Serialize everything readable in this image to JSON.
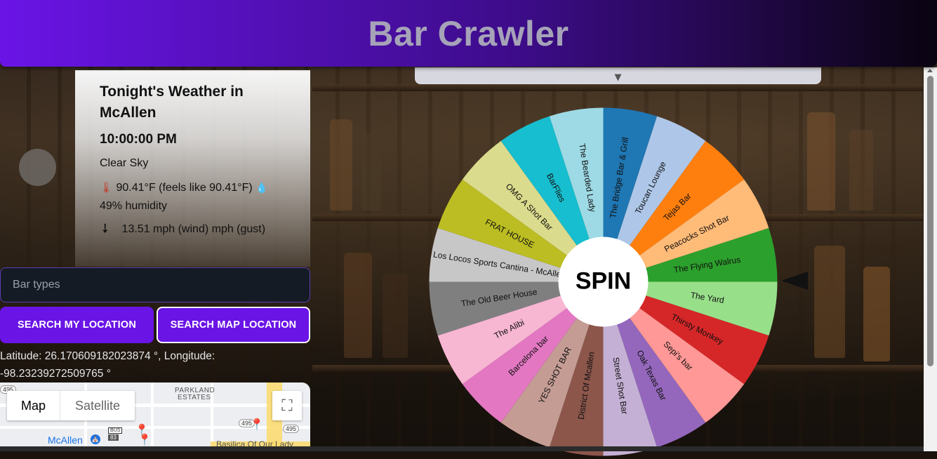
{
  "app": {
    "title": "Bar Crawler"
  },
  "weather": {
    "title": "Tonight's Weather in McAllen",
    "time": "10:00:00 PM",
    "condition": "Clear Sky",
    "temperature_text": "90.41°F (feels like 90.41°F)",
    "humidity_text": "49% humidity",
    "wind_text": "13.51 mph (wind) mph (gust)"
  },
  "search": {
    "placeholder": "Bar types",
    "my_location_label": "SEARCH MY LOCATION",
    "map_location_label": "SEARCH MAP LOCATION"
  },
  "location": {
    "text": "Latitude: 26.170609182023874 °, Longitude: -98.23239272509765 °"
  },
  "map": {
    "tab_map": "Map",
    "tab_satellite": "Satellite",
    "labels": {
      "parkland": "PARKLAND",
      "estates": "ESTATES",
      "mcallen": "McAllen",
      "basilica": "Basilica Of Our Lady",
      "bus": "BUS",
      "bus_num": "83",
      "hwy495a": "495",
      "hwy495b": "495",
      "hwy495c": "495"
    }
  },
  "wheel": {
    "center_label": "SPIN",
    "segments": [
      {
        "name": "The Bridge Bar & Grill",
        "color": "#1f77b4"
      },
      {
        "name": "Toucan Lounge",
        "color": "#aec7e8"
      },
      {
        "name": "Tejas Bar",
        "color": "#ff7f0e"
      },
      {
        "name": "Peacocks Shot Bar",
        "color": "#ffbb78"
      },
      {
        "name": "The Flying Walrus",
        "color": "#2ca02c"
      },
      {
        "name": "The Yard",
        "color": "#98df8a"
      },
      {
        "name": "Thirsty Monkey",
        "color": "#d62728"
      },
      {
        "name": "Sepi's bar",
        "color": "#ff9896"
      },
      {
        "name": "Oak Texas Bar",
        "color": "#9467bd"
      },
      {
        "name": "Street Shot Bar",
        "color": "#c5b0d5"
      },
      {
        "name": "District Of Mcallen",
        "color": "#8c564b"
      },
      {
        "name": "YES SHOT BAR",
        "color": "#c49c94"
      },
      {
        "name": "Barcelona bar",
        "color": "#e377c2"
      },
      {
        "name": "The Alibi",
        "color": "#f7b6d2"
      },
      {
        "name": "The Old Beer House",
        "color": "#7f7f7f"
      },
      {
        "name": "Los Locos Sports Cantina - McAllen",
        "color": "#c7c7c7"
      },
      {
        "name": "FRAT HOUSE",
        "color": "#bcbd22"
      },
      {
        "name": "OMG A Shot Bar",
        "color": "#dbdb8d"
      },
      {
        "name": "BarFlies",
        "color": "#17becf"
      },
      {
        "name": "The Bearded Lady",
        "color": "#9edae5"
      }
    ]
  }
}
